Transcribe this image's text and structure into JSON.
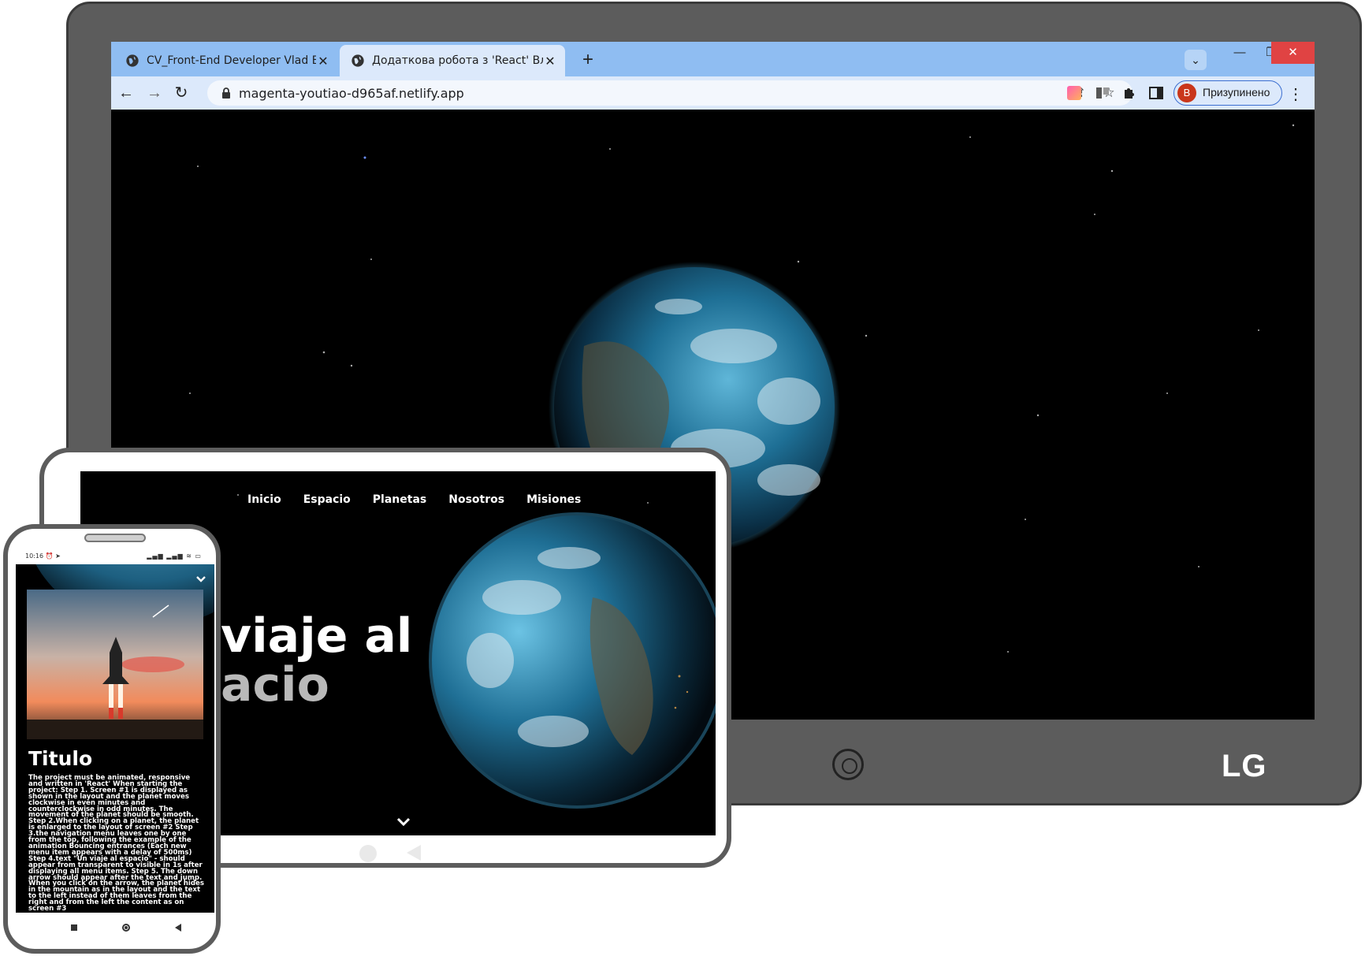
{
  "browser": {
    "tabs": [
      {
        "label": "CV_Front-End Developer Vlad Bro",
        "active": false
      },
      {
        "label": "Додаткова робота з 'React' Влад",
        "active": true
      }
    ],
    "new_tab_label": "+",
    "url": "magenta-youtiao-d965af.netlify.app",
    "profile": {
      "initial": "B",
      "label": "Призупинено",
      "avatar_color": "#c9361b"
    },
    "accent_color": "#8fbdf2"
  },
  "monitor": {
    "brand": "LG"
  },
  "tablet": {
    "nav": [
      "Inicio",
      "Espacio",
      "Planetas",
      "Nosotros",
      "Misiones"
    ],
    "hero_line1": "viaje al",
    "hero_line2": "acio"
  },
  "phone": {
    "status_time": "10:16",
    "status_icons": "⏰ ➤",
    "signal": "▂▄▆ ▂▄▆ ≋ ▭",
    "title": "Titulo",
    "body": "The project must be animated, responsive and written in 'React' When starting the project: Step 1. Screen #1 is displayed as shown in the layout and the planet moves clockwise in even minutes and counterclockwise in odd minutes. The movement of the planet should be smooth. Step 2.When clicking on a planet, the planet is enlarged to the layout of screen #2 Step 3.the navigation menu leaves one by one from the top, following the example of the animation Bouncing entrances (Each new menu item appears with a delay of 500ms) Step 4.text \"Un viaje al espacio\" - should appear from transparent to visible in 1s after displaying all menu items. Step 5. The down arrow should appear after the text and jump. When you click on the arrow, the planet hides in the mountain as in the layout and the text to the left instead of them leaves from the right and from the left the content as on screen #3"
  }
}
